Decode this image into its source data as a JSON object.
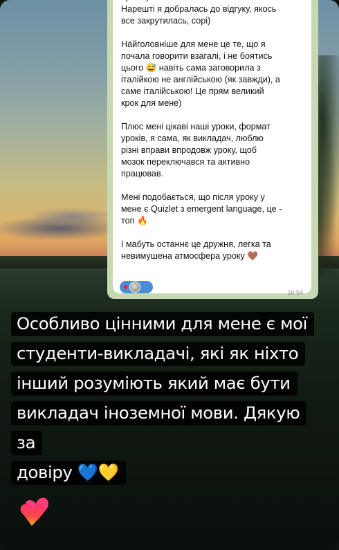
{
  "chat": {
    "message": "привіт)\nНарешті я добралась до відгуку, якось\nвсе закрутилась, сорі)\n\nНайголовніше для мене це те, що я\nпочала говорити взагалі, і не боятись\nцього 😅 навіть сама заговорила з\nіталійкою не англійською (як завжди), а\nсаме італійською! Це прям великий\nкрок для мене)\n\nПлюс мені цікаві наші уроки, формат\nуроків, я сама, як викладач, люблю\nрізні вправи впродовж уроку, щоб\nмозок переключався та активно\nпрацював.\n\nМені подобається, що після уроку у\nмене є Quizlet з emergent language, це -\nтоп 🔥\n\nІ мабуть останнє це дружня, легка та\nневимушена атмосфера уроку 🤎",
    "reaction_icon": "red-heart",
    "time": "16:54"
  },
  "caption": {
    "lines": [
      "Особливо цінними для мене є мої",
      "студенти-викладачі, які як ніхто",
      "інший розуміють який має бути",
      "викладач іноземної мови. Дякую за",
      "довіру"
    ],
    "emoji_1": "💙",
    "emoji_2": "💛"
  },
  "like_icon": "heart-gradient-like",
  "colors": {
    "chat_background": "#c9d8b4",
    "reaction_pill": "#4a8fd6",
    "heart_red": "#e0242f",
    "like_gradient_top": "#ff3a6e",
    "like_gradient_bottom": "#ffb020"
  }
}
